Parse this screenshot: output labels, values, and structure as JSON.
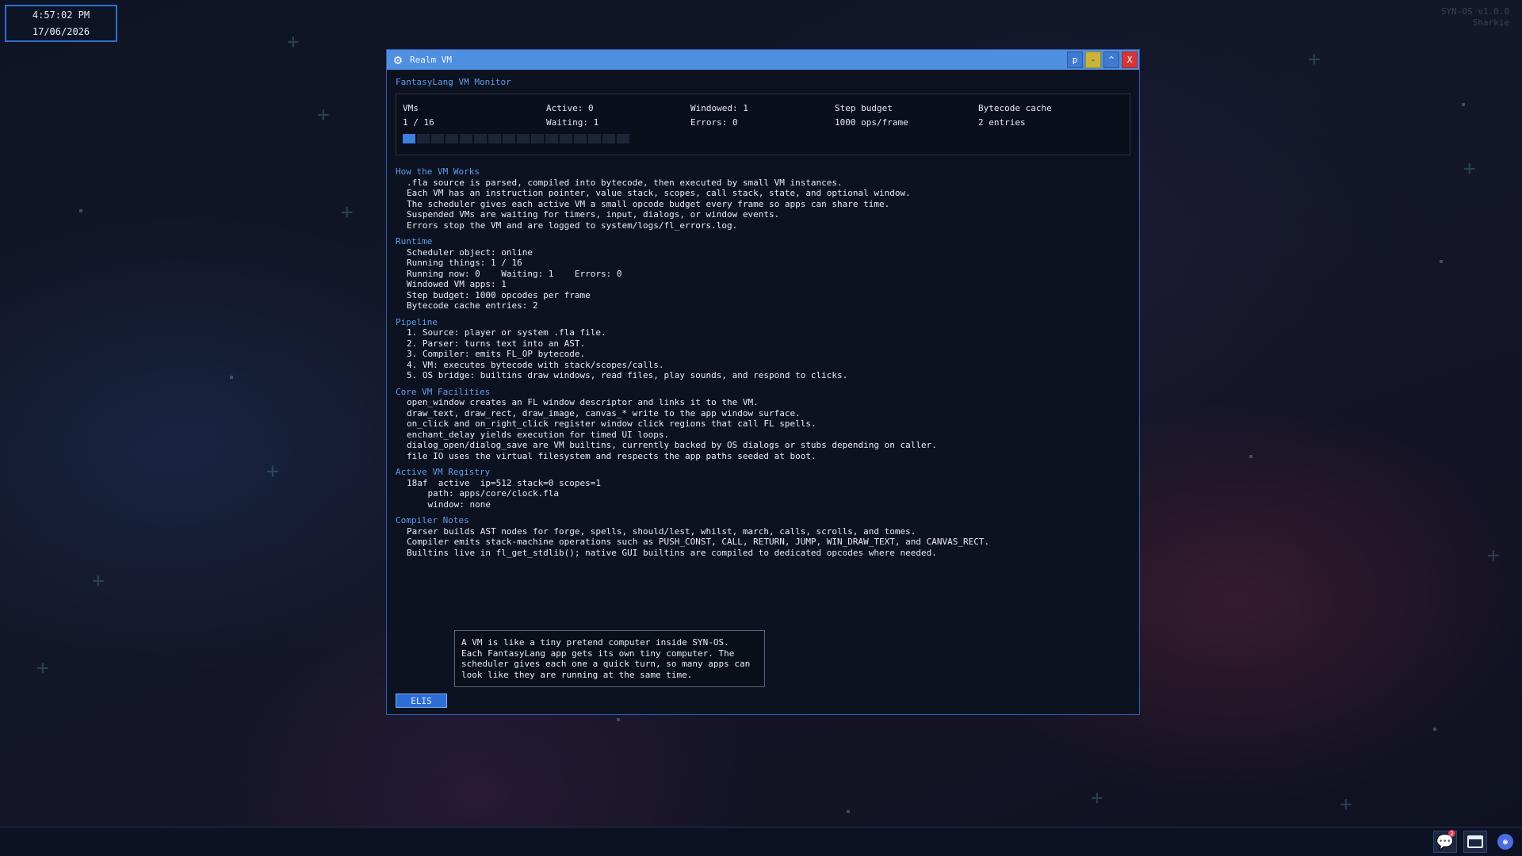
{
  "desktop": {
    "clock": {
      "time": "4:57:02 PM",
      "date": "17/06/2026"
    },
    "os_info": {
      "version": "SYN-OS v1.0.0",
      "user": "Sharkie"
    }
  },
  "window": {
    "title": "Realm VM",
    "icon": "gear-icon",
    "buttons": {
      "pin": "p",
      "minimize": "-",
      "maximize": "^",
      "close": "X"
    },
    "monitor_title": "FantasyLang VM Monitor",
    "stats": {
      "vms_label": "VMs",
      "vms_value": "1 / 16",
      "active": "Active: 0",
      "waiting": "Waiting: 1",
      "windowed": "Windowed: 1",
      "errors": "Errors: 0",
      "step_label": "Step budget",
      "step_value": "1000 ops/frame",
      "cache_label": "Bytecode cache",
      "cache_value": "2 entries",
      "usage_used": 1,
      "usage_total": 16
    },
    "sections": [
      {
        "heading": "How the VM Works",
        "lines": [
          ".fla source is parsed, compiled into bytecode, then executed by small VM instances.",
          "Each VM has an instruction pointer, value stack, scopes, call stack, state, and optional window.",
          "The scheduler gives each active VM a small opcode budget every frame so apps can share time.",
          "Suspended VMs are waiting for timers, input, dialogs, or window events.",
          "Errors stop the VM and are logged to system/logs/fl_errors.log."
        ]
      },
      {
        "heading": "Runtime",
        "lines": [
          "Scheduler object: online",
          "Running things: 1 / 16",
          "Running now: 0    Waiting: 1    Errors: 0",
          "Windowed VM apps: 1",
          "Step budget: 1000 opcodes per frame",
          "Bytecode cache entries: 2"
        ]
      },
      {
        "heading": "Pipeline",
        "lines": [
          "1. Source: player or system .fla file.",
          "2. Parser: turns text into an AST.",
          "3. Compiler: emits FL_OP bytecode.",
          "4. VM: executes bytecode with stack/scopes/calls.",
          "5. OS bridge: builtins draw windows, read files, play sounds, and respond to clicks."
        ]
      },
      {
        "heading": "Core VM Facilities",
        "lines": [
          "open_window creates an FL window descriptor and links it to the VM.",
          "draw_text, draw_rect, draw_image, canvas_* write to the app window surface.",
          "on_click and on_right_click register window click regions that call FL spells.",
          "enchant_delay yields execution for timed UI loops.",
          "dialog_open/dialog_save are VM builtins, currently backed by OS dialogs or stubs depending on caller.",
          "file IO uses the virtual filesystem and respects the app paths seeded at boot."
        ]
      },
      {
        "heading": "Active VM Registry",
        "lines": [
          "18af  active  ip=512 stack=0 scopes=1",
          "    path: apps/core/clock.fla",
          "    window: none"
        ]
      },
      {
        "heading": "Compiler Notes",
        "lines": [
          "Parser builds AST nodes for forge, spells, should/lest, whilst, march, calls, scrolls, and tomes.",
          "Compiler emits stack-machine operations such as PUSH_CONST, CALL, RETURN, JUMP, WIN_DRAW_TEXT, and CANVAS_RECT.",
          "Builtins live in fl_get_stdlib(); native GUI builtins are compiled to dedicated opcodes where needed."
        ]
      }
    ],
    "tooltip_lines": [
      "A VM is like a tiny pretend computer inside SYN-OS.",
      "Each FantasyLang app gets its own tiny computer. The",
      "scheduler gives each one a quick turn, so many apps can",
      "look like they are running at the same time."
    ],
    "elis_button": "ELIS"
  },
  "taskbar": {
    "tray": [
      {
        "icon": "chat-icon",
        "badge": "2",
        "active": true
      },
      {
        "icon": "folder-icon",
        "active": true
      },
      {
        "icon": "discord-icon",
        "active": false
      }
    ]
  },
  "colors": {
    "accent": "#4f8fe0",
    "heading": "#5f9be8",
    "close": "#d23838",
    "minimize": "#c9b33a"
  }
}
